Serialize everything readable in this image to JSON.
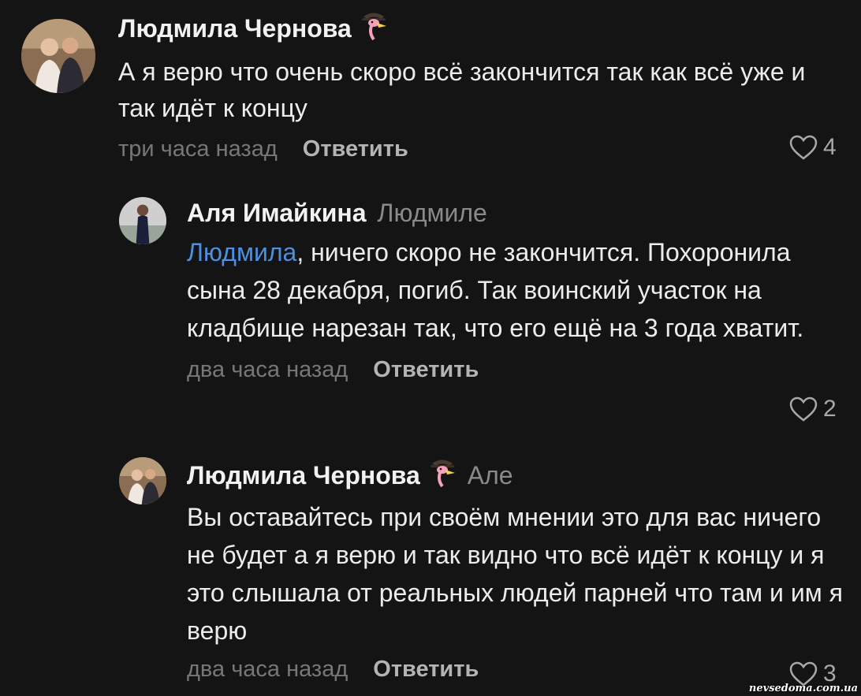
{
  "comments": [
    {
      "author": "Людмила Чернова",
      "reply_to": "",
      "emoji_icon": "pink-flamingo-in-hat",
      "text": "А я верю что очень скоро всё закончится так как всё уже и так идёт к концу",
      "time": "три часа назад",
      "reply_label": "Ответить",
      "likes": "4"
    },
    {
      "author": "Аля Имайкина",
      "reply_to": "Людмиле",
      "mention": "Людмила",
      "text": ", ничего скоро не закончится. Похоронила сына 28 декабря, погиб. Так воинский участок на кладбище нарезан так, что его ещё на 3 года хватит.",
      "time": "два часа назад",
      "reply_label": "Ответить",
      "likes": "2"
    },
    {
      "author": "Людмила Чернова",
      "reply_to": "Але",
      "emoji_icon": "pink-flamingo-in-hat",
      "text": "Вы оставайтесь при своём мнении это для вас ничего не будет а я верю и так видно что всё идёт к концу и я это слышала от реальных людей парней что там и им я верю",
      "time": "два часа назад",
      "reply_label": "Ответить",
      "likes": "3"
    }
  ],
  "watermark": "nevsedoma.com.ua",
  "colors": {
    "background": "#141414",
    "mention": "#4d8fe0",
    "meta": "#777777"
  }
}
